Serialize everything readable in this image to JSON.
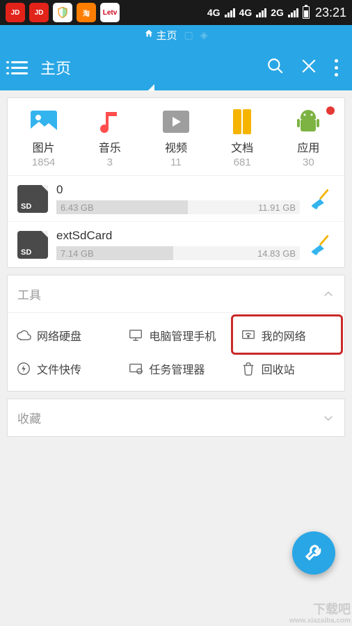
{
  "statusbar": {
    "network_labels": [
      "4G",
      "4G",
      "2G"
    ],
    "clock": "23:21"
  },
  "tab_banner": {
    "label": "主页"
  },
  "topbar": {
    "title": "主页"
  },
  "categories": [
    {
      "label": "图片",
      "count": "1854"
    },
    {
      "label": "音乐",
      "count": "3"
    },
    {
      "label": "视频",
      "count": "11"
    },
    {
      "label": "文档",
      "count": "681"
    },
    {
      "label": "应用",
      "count": "30"
    }
  ],
  "storage": [
    {
      "name": "0",
      "used": "6.43 GB",
      "total": "11.91 GB",
      "fill_pct": 54
    },
    {
      "name": "extSdCard",
      "used": "7.14 GB",
      "total": "14.83 GB",
      "fill_pct": 48
    }
  ],
  "tools": {
    "title": "工具",
    "items": [
      {
        "label": "网络硬盘"
      },
      {
        "label": "电脑管理手机"
      },
      {
        "label": "我的网络",
        "highlighted": true
      },
      {
        "label": "文件快传"
      },
      {
        "label": "任务管理器"
      },
      {
        "label": "回收站"
      }
    ]
  },
  "favorites": {
    "title": "收藏"
  },
  "watermark": {
    "text": "下载吧",
    "url": "www.xiazaiba.com"
  }
}
